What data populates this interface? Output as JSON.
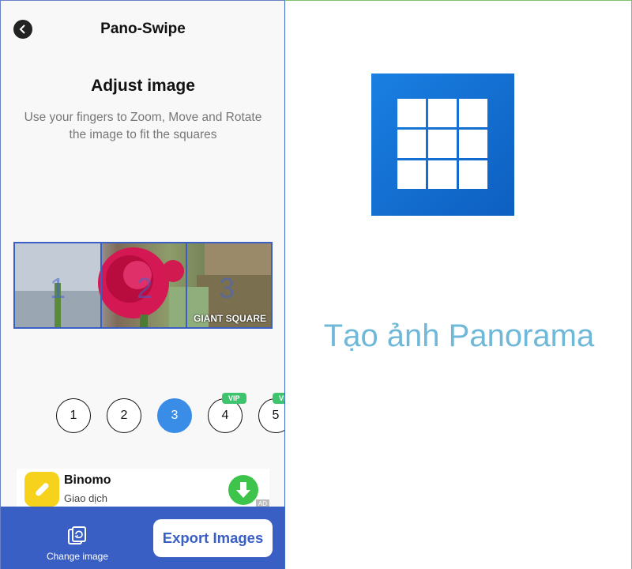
{
  "app": {
    "title": "Pano-Swipe"
  },
  "adjust": {
    "heading": "Adjust image",
    "instruction_line1": "Use your fingers to Zoom, Move and Rotate",
    "instruction_line2": "the image to fit the squares"
  },
  "preview": {
    "segments": [
      "1",
      "2",
      "3"
    ],
    "watermark": "GIANT SQUARE"
  },
  "square_count": {
    "options": [
      "1",
      "2",
      "3",
      "4",
      "5"
    ],
    "selected": "3",
    "vip_badge": "VIP"
  },
  "ad": {
    "name": "Binomo",
    "subtitle": "Giao dịch",
    "tag": "AD"
  },
  "bottom_bar": {
    "change_image_label": "Change image",
    "export_label": "Export Images"
  },
  "right_panel": {
    "caption": "Tạo ảnh Panorama"
  },
  "colors": {
    "accent_blue": "#3a5fc4",
    "selected_circle": "#3a8de6",
    "vip_green": "#3ec46d",
    "caption_color": "#6fb8d8",
    "logo_blue": "#1a7fe2"
  },
  "icons": [
    "back-arrow-icon",
    "change-image-icon",
    "download-arrow-icon",
    "grid-logo-icon"
  ]
}
